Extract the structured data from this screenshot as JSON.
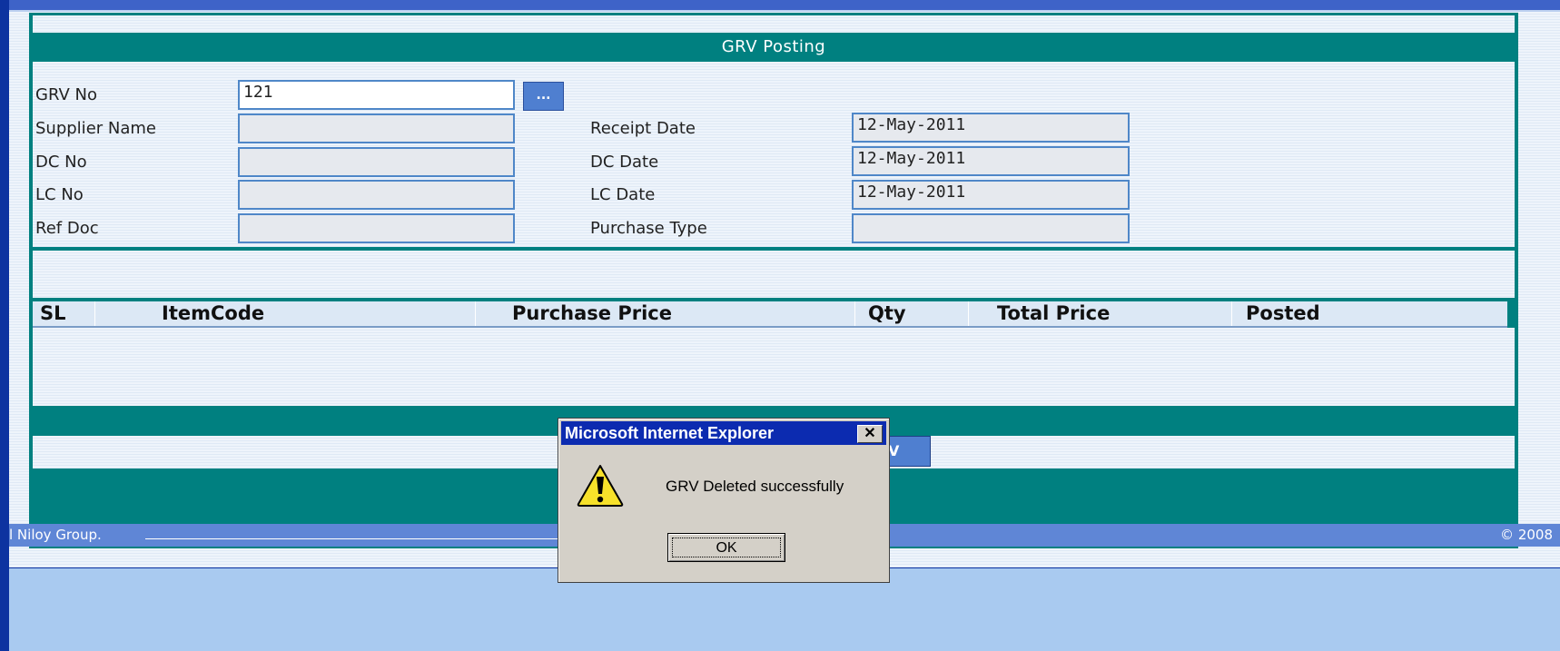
{
  "form": {
    "title": "GRV Posting",
    "fields": {
      "grv_no": {
        "label": "GRV No",
        "value": "121"
      },
      "supplier_name": {
        "label": "Supplier Name",
        "value": ""
      },
      "dc_no": {
        "label": "DC No",
        "value": ""
      },
      "lc_no": {
        "label": "LC No",
        "value": ""
      },
      "ref_doc": {
        "label": "Ref Doc",
        "value": ""
      },
      "receipt_date": {
        "label": "Receipt Date",
        "value": "12-May-2011"
      },
      "dc_date": {
        "label": "DC Date",
        "value": "12-May-2011"
      },
      "lc_date": {
        "label": "LC Date",
        "value": "12-May-2011"
      },
      "purchase_type": {
        "label": "Purchase Type",
        "value": ""
      }
    },
    "browse_button": "..."
  },
  "grid": {
    "columns": [
      "SL",
      "ItemCode",
      "Purchase Price",
      "Qty",
      "Total Price",
      "Posted"
    ]
  },
  "partial_button_label": "V",
  "footer": {
    "left": "l Niloy Group.",
    "right": "© 2008"
  },
  "dialog": {
    "title": "Microsoft Internet Explorer",
    "close": "✕",
    "message": "GRV Deleted successfully",
    "ok": "OK"
  },
  "colors": {
    "teal": "#008080",
    "outer_blue": "#0d33a0",
    "dialog_title": "#0c2bb0",
    "field_border": "#4f87c8"
  }
}
